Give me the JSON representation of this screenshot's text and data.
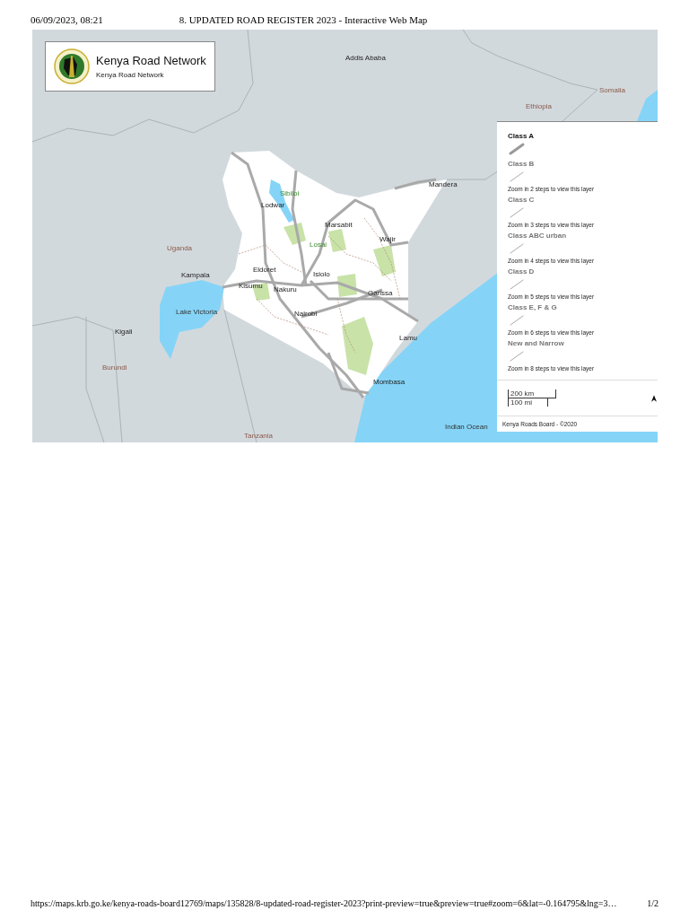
{
  "print_header": {
    "date": "06/09/2023, 08:21",
    "title": "8. UPDATED ROAD REGISTER 2023 - Interactive Web Map"
  },
  "map": {
    "title_card": {
      "title": "Kenya Road Network",
      "subtitle": "Kenya Road Network"
    },
    "labels": [
      {
        "text": "Addis Ababa",
        "kind": "city"
      },
      {
        "text": "Somalia",
        "kind": "country"
      },
      {
        "text": "Ethiopia",
        "kind": "country"
      },
      {
        "text": "Uganda",
        "kind": "country"
      },
      {
        "text": "Kampala",
        "kind": "city"
      },
      {
        "text": "Lake Victoria",
        "kind": "water"
      },
      {
        "text": "Kigali",
        "kind": "city"
      },
      {
        "text": "Burundi",
        "kind": "country"
      },
      {
        "text": "Sibiloi",
        "kind": "park"
      },
      {
        "text": "Lodwar",
        "kind": "city"
      },
      {
        "text": "Marsabit",
        "kind": "city"
      },
      {
        "text": "Losai",
        "kind": "park"
      },
      {
        "text": "Wajir",
        "kind": "city"
      },
      {
        "text": "Mandera",
        "kind": "city"
      },
      {
        "text": "Eldoret",
        "kind": "city"
      },
      {
        "text": "Kisumu",
        "kind": "city"
      },
      {
        "text": "Nakuru",
        "kind": "city"
      },
      {
        "text": "Isiolo",
        "kind": "city"
      },
      {
        "text": "Garissa",
        "kind": "city"
      },
      {
        "text": "Nairobi",
        "kind": "city"
      },
      {
        "text": "Lamu",
        "kind": "city"
      },
      {
        "text": "Mombasa",
        "kind": "city"
      },
      {
        "text": "Indian Ocean",
        "kind": "water"
      },
      {
        "text": "Tanzania",
        "kind": "country"
      }
    ],
    "legend": {
      "layers": [
        {
          "name": "Class A",
          "visible": true
        },
        {
          "name": "Class B",
          "visible": false,
          "hint": "Zoom in 2 steps to view this layer"
        },
        {
          "name": "Class C",
          "visible": false,
          "hint": "Zoom in 3 steps to view this layer"
        },
        {
          "name": "Class ABC urban",
          "visible": false,
          "hint": "Zoom in 4 steps to view this layer"
        },
        {
          "name": "Class D",
          "visible": false,
          "hint": "Zoom in 5 steps to view this layer"
        },
        {
          "name": "Class E, F & G",
          "visible": false,
          "hint": "Zoom in 6 steps to view this layer"
        },
        {
          "name": "New and Narrow",
          "visible": false,
          "hint": "Zoom in 8 steps to view this layer"
        }
      ],
      "scale": {
        "metric": "200 km",
        "imperial": "100 mi"
      },
      "attribution": "Kenya Roads Board - ©2020"
    }
  },
  "print_footer": {
    "url": "https://maps.krb.go.ke/kenya-roads-board12769/maps/135828/8-updated-road-register-2023?print-preview=true&preview=true#zoom=6&lat=-0.164795&lng=3…",
    "page": "1/2"
  }
}
